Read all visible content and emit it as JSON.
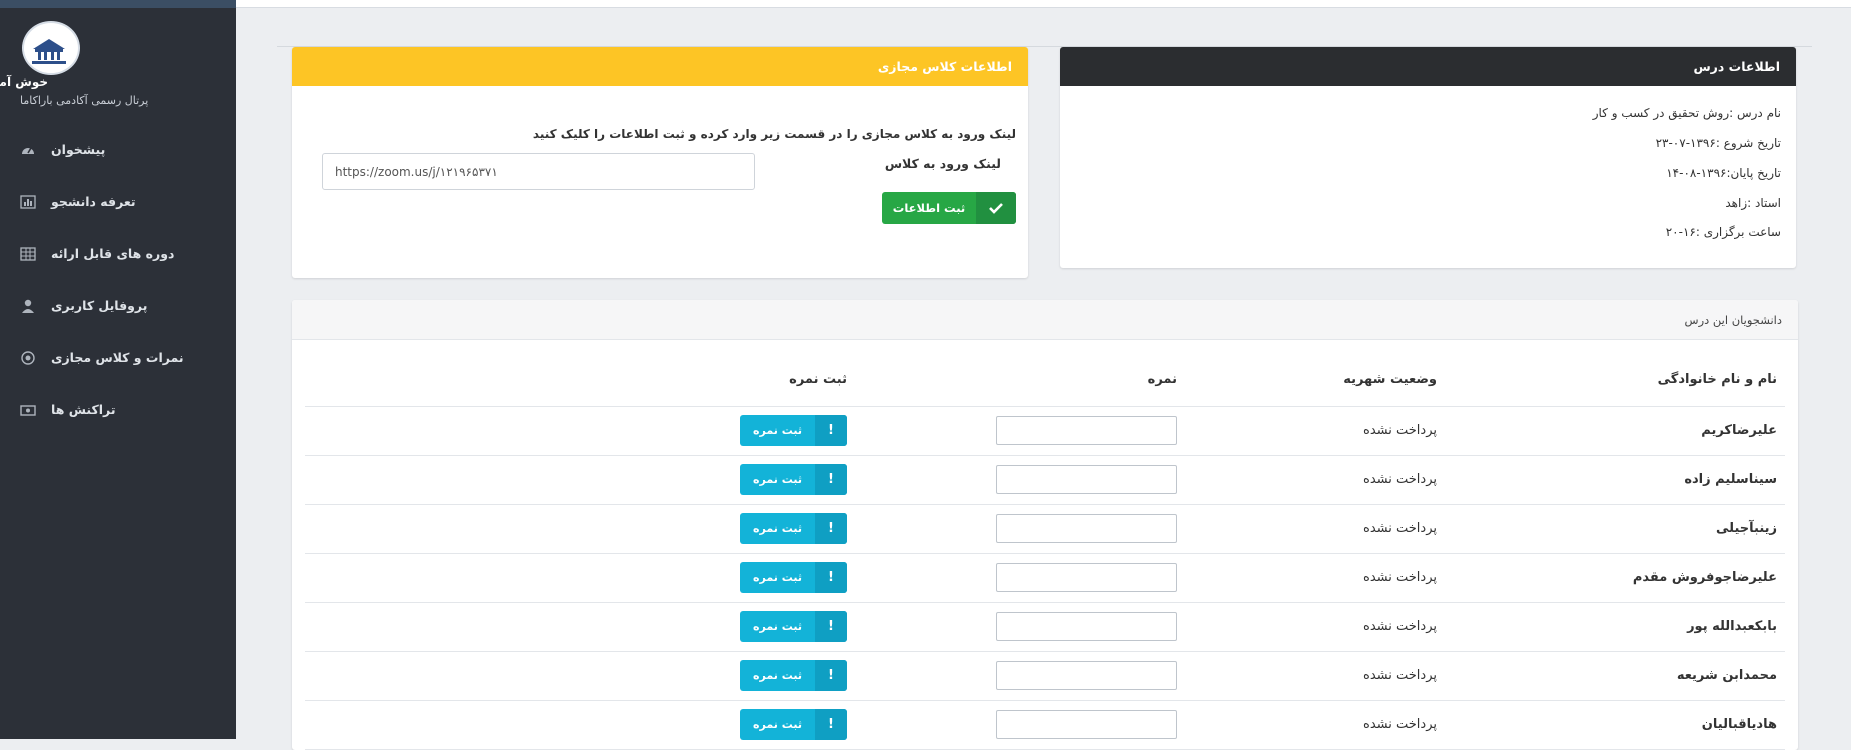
{
  "sidebar": {
    "logo_name": "Baranekama logo",
    "welcome": "خوش آمدید",
    "subtitle": "پرتال رسمی آکادمی باراکاما",
    "items": [
      {
        "label": "پیشخوان",
        "icon": "dashboard-icon"
      },
      {
        "label": "تعرفه دانشجو",
        "icon": "bar-chart-icon"
      },
      {
        "label": "دوره های قابل ارائه",
        "icon": "table-icon"
      },
      {
        "label": "پروفایل کاربری",
        "icon": "user-icon"
      },
      {
        "label": "نمرات و کلاس مجازی",
        "icon": "record-icon"
      },
      {
        "label": "تراکنش ها",
        "icon": "money-icon"
      }
    ]
  },
  "course_info": {
    "title": "اطلاعات درس",
    "course_name": "نام درس :روش تحقیق در کسب و کار",
    "start_date": "تاریخ شروع :۱۳۹۶-۰۷-۲۳",
    "end_date": "تاریخ پایان:۱۳۹۶-۰۸-۱۴",
    "teacher": "استاد :زاهد",
    "time": "ساعت برگزاری :۱۶-۲۰"
  },
  "virtual_class": {
    "title": "اطلاعات کلاس مجازی",
    "note": "لینک ورود به کلاس مجازی را در قسمت زیر وارد کرده و ثبت اطلاعات را کلیک کنید",
    "link_label": "لینک ورود به کلاس",
    "link_value": "https://zoom.us/j/۱۲۱۹۶۵۳۷۱",
    "save_label": "ثبت اطلاعات",
    "save_icon": "check-icon"
  },
  "students": {
    "title": "دانشجویان این درس",
    "columns": [
      "نام و نام خانوادگی",
      "وضعیت شهریه",
      "نمره",
      "ثبت نمره"
    ],
    "button_label": "ثبت نمره",
    "button_icon": "exclamation-icon",
    "rows": [
      {
        "name": "علیرضاکریم",
        "status": "پرداخت نشده"
      },
      {
        "name": "سیناسلیم زاده",
        "status": "پرداخت نشده"
      },
      {
        "name": "زینبآجیلی",
        "status": "پرداخت نشده"
      },
      {
        "name": "علیرضاجوفروش مقدم",
        "status": "پرداخت نشده"
      },
      {
        "name": "بابکعبدالله پور",
        "status": "پرداخت نشده"
      },
      {
        "name": "محمدابن شریعه",
        "status": "پرداخت نشده"
      },
      {
        "name": "هادیاقبالیان",
        "status": "پرداخت نشده"
      }
    ]
  },
  "colors": {
    "sidebar_bg": "#2c3038",
    "course_header": "#2b2d30",
    "class_header": "#fdc525",
    "save_green": "#27a745",
    "row_button": "#13b3d8"
  }
}
